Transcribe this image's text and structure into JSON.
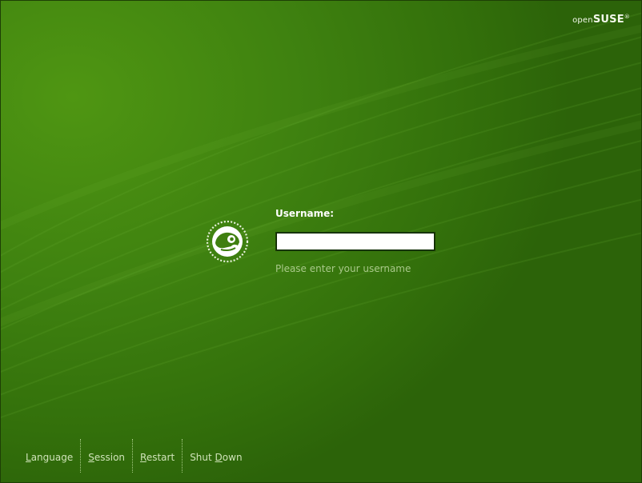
{
  "brand": {
    "prefix": "open",
    "name": "SUSE",
    "mark": "®"
  },
  "logo": {
    "icon": "opensuse-chameleon-icon"
  },
  "login": {
    "username_label": "Username:",
    "username_value": "",
    "hint": "Please enter your username"
  },
  "footer": {
    "buttons": [
      {
        "accel": "L",
        "rest": "anguage",
        "prefix": ""
      },
      {
        "accel": "S",
        "rest": "ession",
        "prefix": ""
      },
      {
        "accel": "R",
        "rest": "estart",
        "prefix": ""
      },
      {
        "accel": "D",
        "rest": "own",
        "prefix": "Shut "
      }
    ]
  },
  "colors": {
    "background": "#3e7a10",
    "label": "#ffffff",
    "hint": "#a9c98a"
  }
}
